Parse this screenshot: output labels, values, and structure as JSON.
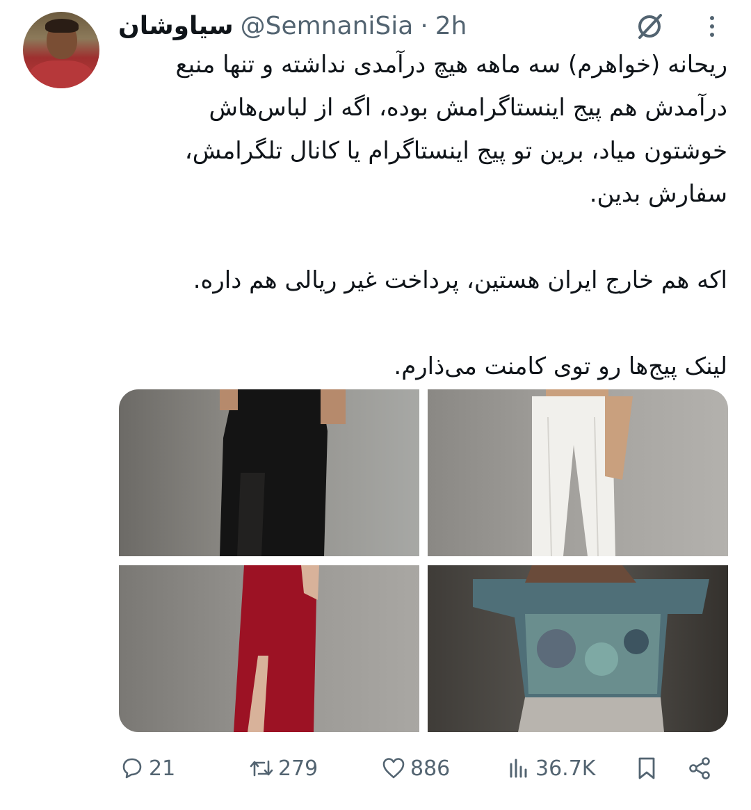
{
  "tweet": {
    "author_name": "سیاوشان",
    "handle": "@SemnaniSia",
    "separator": "·",
    "time": "2h",
    "text_paragraphs": [
      "ریحانه (خواهرم) سه ماهه هیچ درآمدی نداشته و تنها منبع درآمدش هم پیج اینستاگرامش بوده، اگه از لباس‌هاش خوشتون میاد، برین تو پیج اینستاگرام یا کانال تلگرامش، سفارش بدین.",
      "اکه هم خارج ایران هستین، پرداخت غیر ریالی هم داره.",
      "لینک پیج‌ها رو توی کامنت می‌ذارم."
    ]
  },
  "icons": {
    "grok": "grok-icon",
    "more": "more-vertical-icon",
    "reply": "reply-icon",
    "retweet": "retweet-icon",
    "like": "heart-icon",
    "views": "views-icon",
    "bookmark": "bookmark-icon",
    "share": "share-icon"
  },
  "actions": {
    "replies": "21",
    "retweets": "279",
    "likes": "886",
    "views": "36.7K"
  },
  "colors": {
    "text": "#0f1419",
    "secondary": "#536471"
  }
}
